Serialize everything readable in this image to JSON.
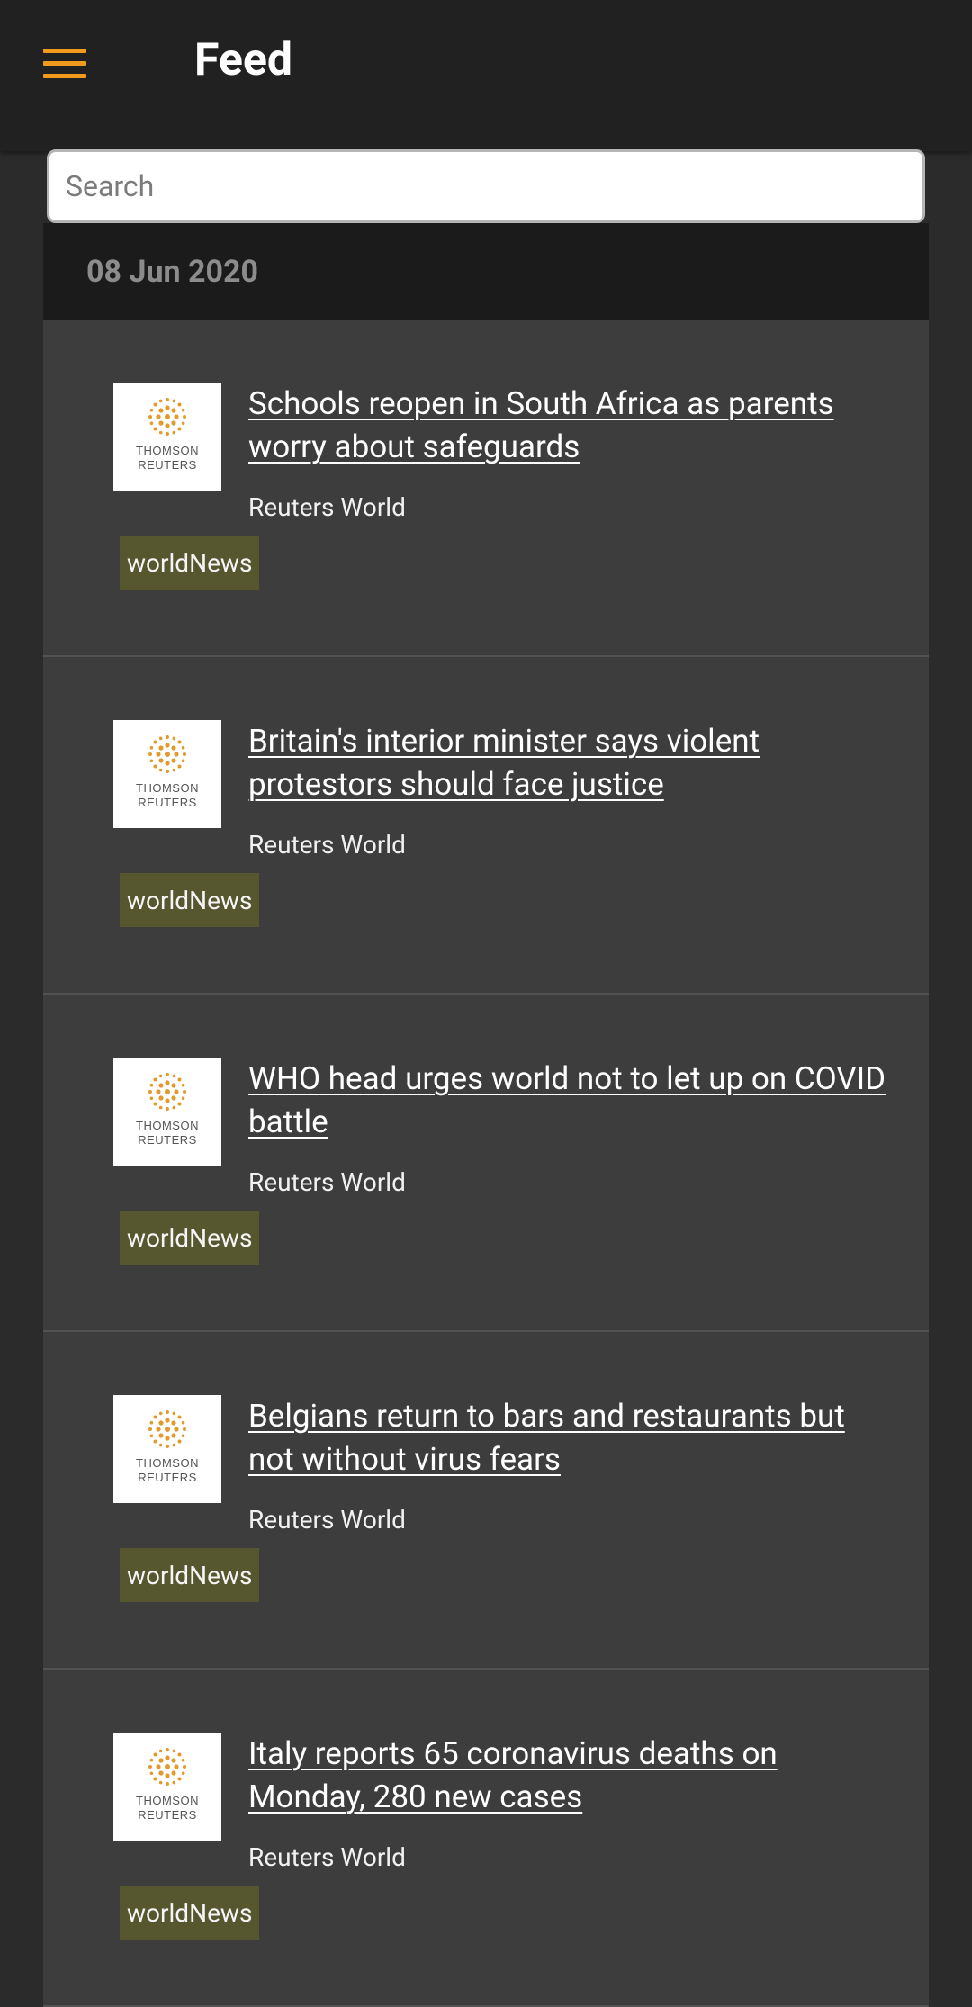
{
  "app": {
    "title": "Feed"
  },
  "search": {
    "placeholder": "Search",
    "value": ""
  },
  "feed": {
    "date": "08 Jun 2020",
    "items": [
      {
        "title": "Schools reopen in South Africa as parents worry about safeguards",
        "source": "Reuters World",
        "tag": "worldNews",
        "logo_line1": "THOMSON",
        "logo_line2": "REUTERS"
      },
      {
        "title": "Britain's interior minister says violent protestors should face justice",
        "source": "Reuters World",
        "tag": "worldNews",
        "logo_line1": "THOMSON",
        "logo_line2": "REUTERS"
      },
      {
        "title": "WHO head urges world not to let up on COVID battle",
        "source": "Reuters World",
        "tag": "worldNews",
        "logo_line1": "THOMSON",
        "logo_line2": "REUTERS"
      },
      {
        "title": "Belgians return to bars and restaurants but not without virus fears",
        "source": "Reuters World",
        "tag": "worldNews",
        "logo_line1": "THOMSON",
        "logo_line2": "REUTERS"
      },
      {
        "title": "Italy reports 65 coronavirus deaths on Monday, 280 new cases",
        "source": "Reuters World",
        "tag": "worldNews",
        "logo_line1": "THOMSON",
        "logo_line2": "REUTERS"
      }
    ]
  },
  "icons": {
    "menu": "hamburger-menu-icon",
    "logo": "thomson-reuters-logo"
  },
  "colors": {
    "accent": "#f29a1b",
    "appbar": "#212121",
    "card": "#3d3d3d",
    "tag_bg": "#56572f",
    "date_bg": "#1b1b1b"
  }
}
